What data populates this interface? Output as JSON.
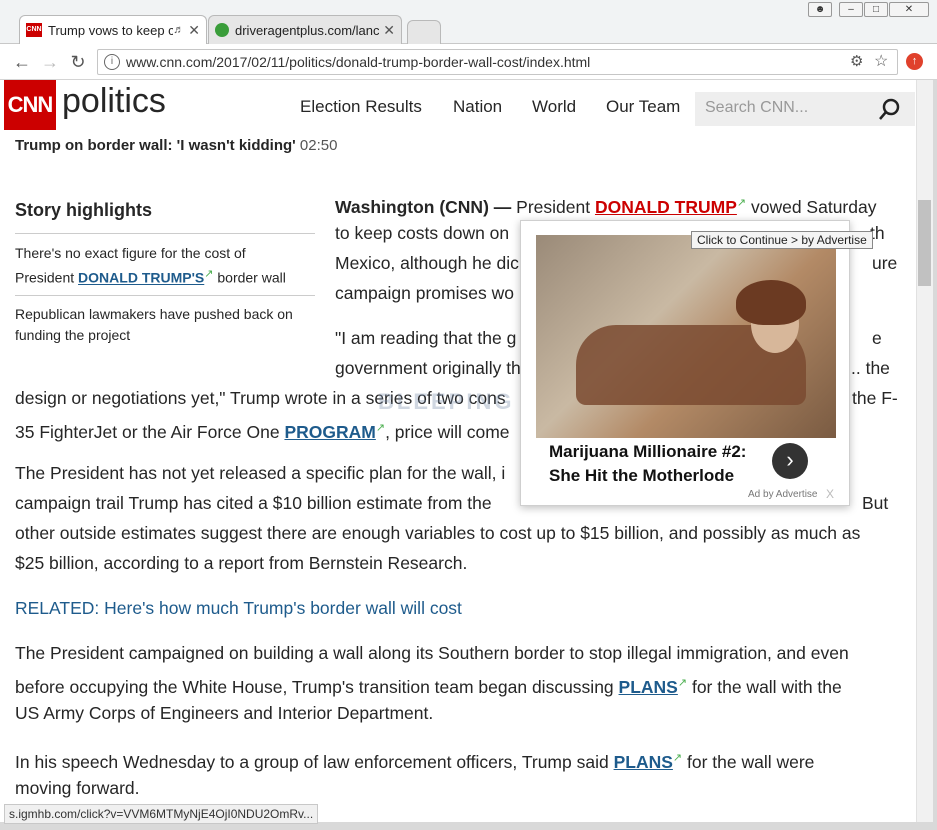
{
  "tabs": [
    {
      "label": "Trump vows to keep c",
      "favicon": "CNN",
      "active": true
    },
    {
      "label": "driveragentplus.com/lanc",
      "favicon": "globe",
      "active": false
    }
  ],
  "toolbar": {
    "url": "www.cnn.com/2017/02/11/politics/donald-trump-border-wall-cost/index.html"
  },
  "header": {
    "logo": "CNN",
    "section": "politics",
    "nav": [
      "Election Results",
      "Nation",
      "World",
      "Our Team"
    ],
    "search_placeholder": "Search CNN..."
  },
  "video_title": "Trump on border wall: 'I wasn't kidding'",
  "video_duration": "02:50",
  "highlights": {
    "title": "Story highlights",
    "item1_pre": "There's no exact figure for the cost of",
    "item1_pre2": "President",
    "item1_link": "DONALD TRUMP'S",
    "item1_post": "border wall",
    "item2_line1": "Republican lawmakers have pushed back on",
    "item2_line2": "funding the project"
  },
  "article": {
    "dateline": "Washington (CNN) —",
    "p1_a": "President",
    "p1_link": "DONALD TRUMP",
    "p1_b": "vowed Saturday",
    "p1_l2": "to keep costs down on",
    "p1_l2b": "th",
    "p1_l3": "Mexico, although he dic",
    "p1_l3b": "ure",
    "p1_l4": "campaign promises wo",
    "p2_l1": "\"I am reading that the g",
    "p2_l1b": "e",
    "p2_l2": "government originally th",
    "p2_l2b": ".. the",
    "p2_l3a": "design or negotiations yet,\" Trump wrote in a series of two cons",
    "p2_l3b": "the F-",
    "p2_l4a": "35 FighterJet or the Air Force One",
    "p2_l4link": "PROGRAM",
    "p2_l4b": ", price will come",
    "p3_l1": "The President has not yet released a specific plan for the wall, i",
    "p3_l2a": "campaign trail Trump has cited a $10 billion estimate from the",
    "p3_l2b": "But",
    "p3_l3": "other outside estimates suggest there are enough variables to cost up to $15 billion, and possibly as much as",
    "p3_l4": "$25 billion, according to a report from Bernstein Research.",
    "related": "RELATED: Here's how much Trump's border wall will cost",
    "p4_l1": "The President campaigned on building a wall along its Southern border to stop illegal immigration, and even",
    "p4_l2a": "before occupying the White House, Trump's transition team began discussing",
    "p4_l2link": "PLANS",
    "p4_l2b": "for the wall with the",
    "p4_l3": "US Army Corps of Engineers and Interior Department.",
    "p5_l1a": "In his speech Wednesday to a group of law enforcement officers, Trump said",
    "p5_l1link": "PLANS",
    "p5_l1b": "for the wall were",
    "p5_l2": "moving forward."
  },
  "ad": {
    "tooltip": "Click to Continue > by Advertise",
    "title": "Marijuana Millionaire #2: She Hit the Motherlode",
    "by": "Ad by Advertise",
    "close": "X"
  },
  "watermark": "BLEEPING COMPUTER",
  "status": "s.igmhb.com/click?v=VVM6MTMyNjE4OjI0NDU2OmRv..."
}
